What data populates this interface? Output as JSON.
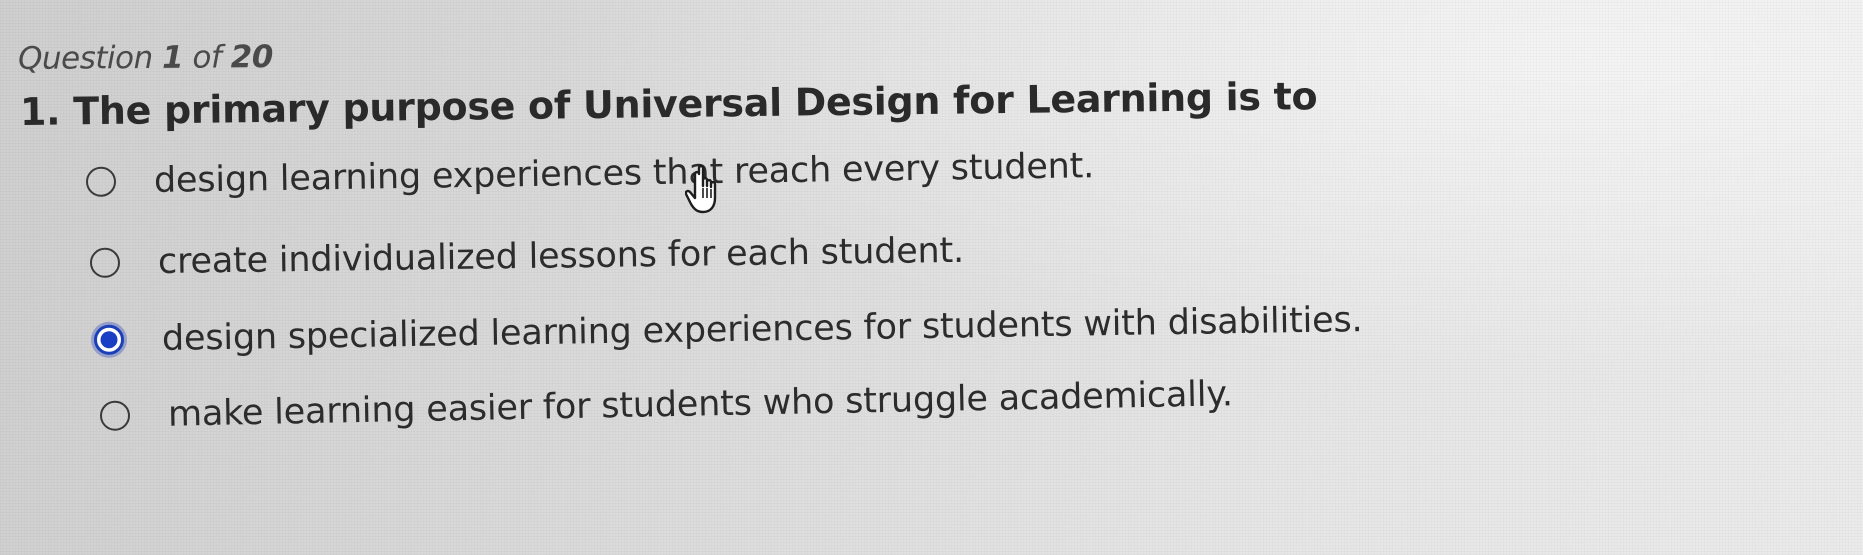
{
  "quiz": {
    "counter_prefix": "Question",
    "current": "1",
    "of_word": "of",
    "total": "20",
    "question_text": "1. The primary purpose of Universal Design for Learning is to",
    "options": [
      {
        "label": "design learning experiences that reach every student.",
        "selected": false
      },
      {
        "label": "create individualized lessons for each student.",
        "selected": false
      },
      {
        "label": "design specialized learning experiences for students with disabilities.",
        "selected": true
      },
      {
        "label": "make learning easier for students who struggle academically.",
        "selected": false
      }
    ]
  },
  "colors": {
    "selected_radio": "#1b3fc4",
    "text": "#2c2c2c"
  },
  "cursor": {
    "icon": "hand-pointer-icon"
  }
}
